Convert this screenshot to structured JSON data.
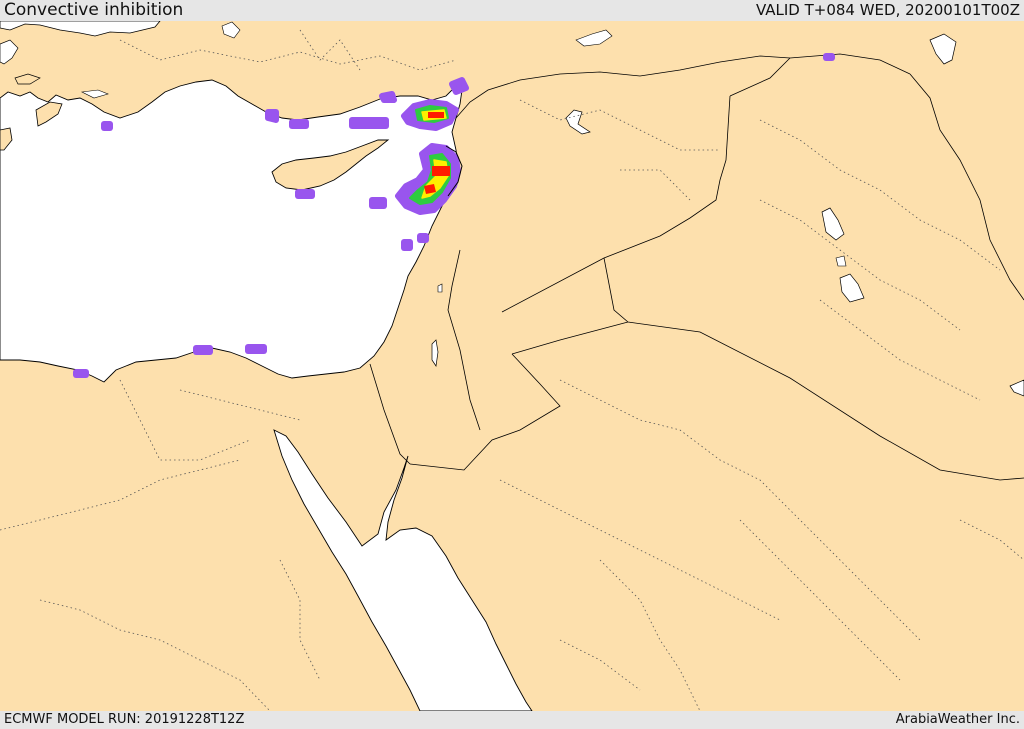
{
  "header": {
    "title": "Convective inhibition",
    "valid": "VALID T+084 WED, 20200101T00Z"
  },
  "footer": {
    "model_run": "ECMWF MODEL RUN: 20191228T12Z",
    "credit": "ArabiaWeather Inc."
  },
  "colors": {
    "land": "#fde0ad",
    "sea": "#ffffff",
    "coast": "#000000",
    "cin_low": "#9955ee",
    "cin_mid": "#2ecc40",
    "cin_high": "#ffee00",
    "cin_max": "#ff1a00"
  }
}
